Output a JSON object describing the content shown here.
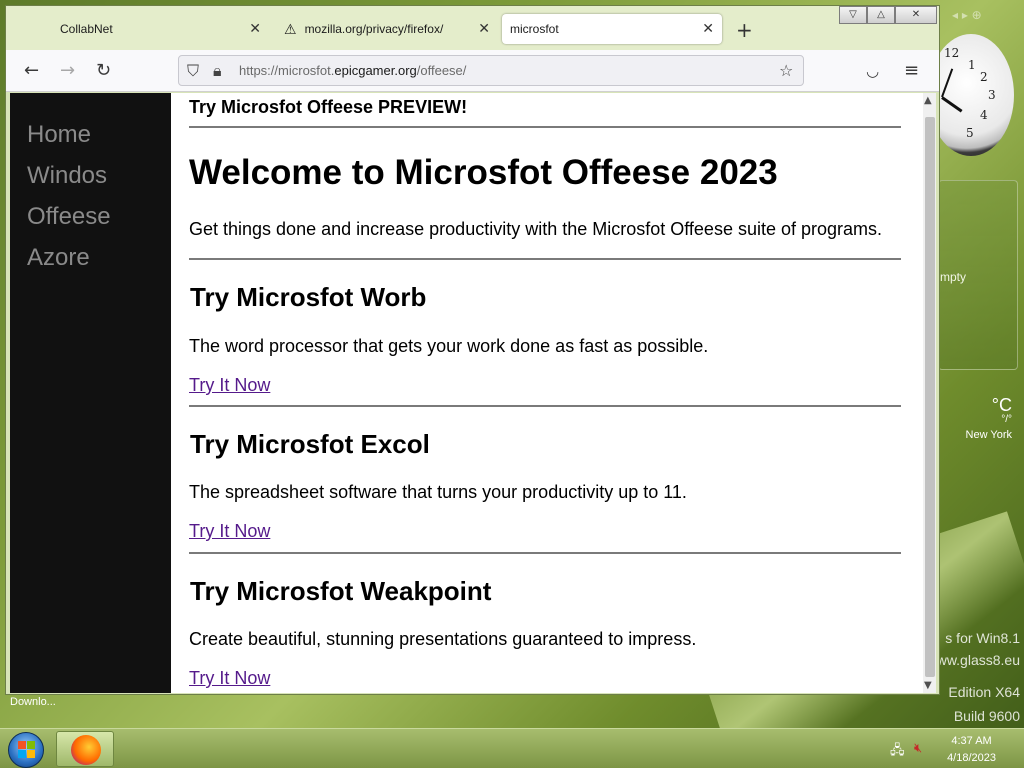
{
  "browser": {
    "tabs": [
      {
        "label": "CollabNet",
        "active": false
      },
      {
        "label": "mozilla.org/privacy/firefox/",
        "active": false,
        "icon": "warning-icon"
      },
      {
        "label": "microsfot",
        "active": true
      }
    ],
    "url": {
      "prefix": "https://microsfot.",
      "domain": "epicgamer.org",
      "path": "/offeese/"
    },
    "status": "Downlo..."
  },
  "page": {
    "nav": [
      "Home",
      "Windos",
      "Offeese",
      "Azore"
    ],
    "preview": "Try Microsfot Offeese PREVIEW!",
    "title": "Welcome to Microsfot Offeese 2023",
    "intro": "Get things done and increase productivity with the Microsfot Offeese suite of programs.",
    "products": [
      {
        "name": "Try Microsfot Worb",
        "desc": "The word processor that gets your work done as fast as possible.",
        "link": "Try It Now"
      },
      {
        "name": "Try Microsfot Excol",
        "desc": "The spreadsheet software that turns your productivity up to 11.",
        "link": "Try It Now"
      },
      {
        "name": "Try Microsfot Weakpoint",
        "desc": "Create beautiful, stunning presentations guaranteed to impress.",
        "link": "Try It Now"
      }
    ]
  },
  "desktop": {
    "sidebar_empty": "mpty",
    "weather": {
      "deg": "°C",
      "range": "°/°",
      "city": "New York"
    },
    "watermark": [
      "s for Win8.1",
      "ww.glass8.eu",
      "Edition X64",
      "Build 9600"
    ],
    "clock_numbers": [
      "12",
      "1",
      "2",
      "3",
      "4",
      "5"
    ]
  },
  "taskbar": {
    "time": "4:37 AM",
    "date": "4/18/2023"
  }
}
